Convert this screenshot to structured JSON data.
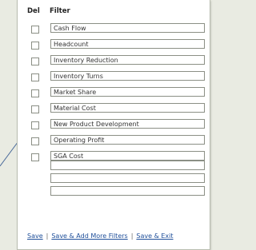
{
  "headers": {
    "del": "Del",
    "filter": "Filter"
  },
  "filters": [
    "Cash Flow",
    "Headcount",
    "Inventory Reduction",
    "Inventory Turns",
    "Market Share",
    "Material Cost",
    "New Product Development",
    "Operating Profit",
    "SGA Cost"
  ],
  "empty_fields": [
    "",
    "",
    ""
  ],
  "links": {
    "save": "Save",
    "save_add_more": "Save & Add More Filters",
    "save_exit": "Save & Exit",
    "separator": "|"
  }
}
